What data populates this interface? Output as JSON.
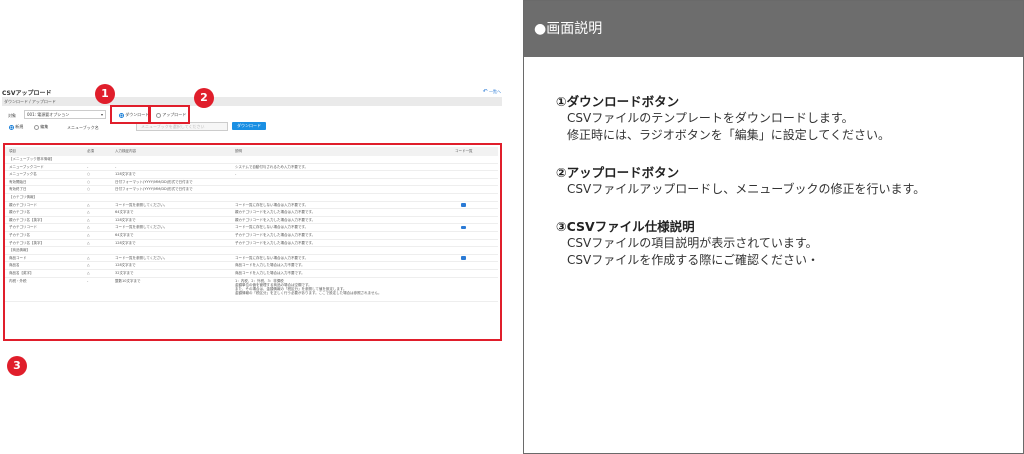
{
  "app": {
    "title": "CSVアップロード",
    "back_label": "一覧へ",
    "tab_label": "ダウンロード / アップロード",
    "kind_label": "対象",
    "kind_value": "001: 電源要オプション",
    "download_radio": "ダウンロード",
    "upload_radio": "アップロード",
    "new_radio": "新規",
    "edit_radio": "編集",
    "menu_book_label": "メニューブック名",
    "menu_book_placeholder": "メニューブックを選択してください",
    "download_button": "ダウンロード"
  },
  "spec": {
    "headers": [
      "項目",
      "必須",
      "入力検証内容",
      "説明",
      "コード一覧"
    ],
    "rows": [
      {
        "type": "section",
        "cells": [
          "【メニューブック基本情報】",
          "",
          "",
          "",
          ""
        ]
      },
      {
        "type": "row",
        "cells": [
          "メニューブックコード",
          "-",
          "-",
          "システムで自動付与されるため入力不要です。",
          ""
        ],
        "book": false
      },
      {
        "type": "row",
        "cells": [
          "メニューブック名",
          "○",
          "128文字まで",
          "-",
          ""
        ],
        "book": false
      },
      {
        "type": "row",
        "cells": [
          "有効開始日",
          "○",
          "日付フォーマット(YYYY/MM/DD)形式で日付まで",
          "",
          ""
        ],
        "book": false
      },
      {
        "type": "row",
        "cells": [
          "有効終了日",
          "○",
          "日付フォーマット(YYYY/MM/DD)形式で日付まで",
          "",
          ""
        ],
        "book": false
      },
      {
        "type": "section",
        "cells": [
          "【カテゴリ情報】",
          "",
          "",
          "",
          ""
        ]
      },
      {
        "type": "row",
        "cells": [
          "親カテゴリコード",
          "△",
          "コード一覧を参照してください。",
          "コード一覧に存在しない場合は入力不要です。",
          ""
        ],
        "book": true
      },
      {
        "type": "row",
        "cells": [
          "親カテゴリ名",
          "△",
          "64文字まで",
          "親カテゴリコードを入力した場合は入力不要です。",
          ""
        ],
        "book": false
      },
      {
        "type": "row",
        "cells": [
          "親カテゴリ名【英字】",
          "△",
          "128文字まで",
          "親カテゴリコードを入力した場合は入力不要です。",
          ""
        ],
        "book": false
      },
      {
        "type": "row",
        "cells": [
          "子カテゴリコード",
          "△",
          "コード一覧を参照してください。",
          "コード一覧に存在しない場合は入力不要です。",
          ""
        ],
        "book": true
      },
      {
        "type": "row",
        "cells": [
          "子カテゴリ名",
          "△",
          "64文字まで",
          "子カテゴリコードを入力した場合は入力不要です。",
          ""
        ],
        "book": false
      },
      {
        "type": "row",
        "cells": [
          "子カテゴリ名【英字】",
          "△",
          "128文字まで",
          "子カテゴリコードを入力した場合は入力不要です。",
          ""
        ],
        "book": false
      },
      {
        "type": "section",
        "cells": [
          "【商品情報】",
          "",
          "",
          "",
          ""
        ]
      },
      {
        "type": "row",
        "cells": [
          "商品コード",
          "△",
          "コード一覧を参照してください。",
          "コード一覧に存在しない場合は入力不要です。",
          ""
        ],
        "book": true
      },
      {
        "type": "row",
        "cells": [
          "商品名",
          "△",
          "128文字まで",
          "商品コードを入力した場合は入力不要です。",
          ""
        ],
        "book": false
      },
      {
        "type": "row",
        "cells": [
          "商品名【英字】",
          "△",
          "32文字まで",
          "商品コードを入力した場合は入力不要です。",
          ""
        ],
        "book": false
      }
    ],
    "last_row": {
      "cells": [
        "内税・外税",
        "-",
        "整数10文字まで",
        "",
        ""
      ],
      "desc_lines": [
        "1：内税、2：外税、3：非課税",
        "金額単位の値を管理する商品の場合は空欄です。",
        "また、その場合は、金額情報の「税区分」を参照して値を設定します。",
        "金額情報の「税区分」を正しく行う必要があります。ここで設定した場合は参照されません。"
      ]
    }
  },
  "badges": [
    "1",
    "2",
    "3"
  ],
  "panel": {
    "title": "●画面説明",
    "sections": [
      {
        "title": "①ダウンロードボタン",
        "lines": [
          "CSVファイルのテンプレートをダウンロードします。",
          "修正時には、ラジオボタンを「編集」に設定してください。"
        ]
      },
      {
        "title": "②アップロードボタン",
        "lines": [
          "CSVファイルアップロードし、メニューブックの修正を行います。"
        ]
      },
      {
        "title": "③CSVファイル仕様説明",
        "lines": [
          "CSVファイルの項目説明が表示されています。",
          "CSVファイルを作成する際にご確認ください・"
        ]
      }
    ]
  },
  "colors": {
    "accent": "#1a8fe3",
    "highlight": "#e01e2b",
    "panel_header": "#6d6d6d"
  }
}
